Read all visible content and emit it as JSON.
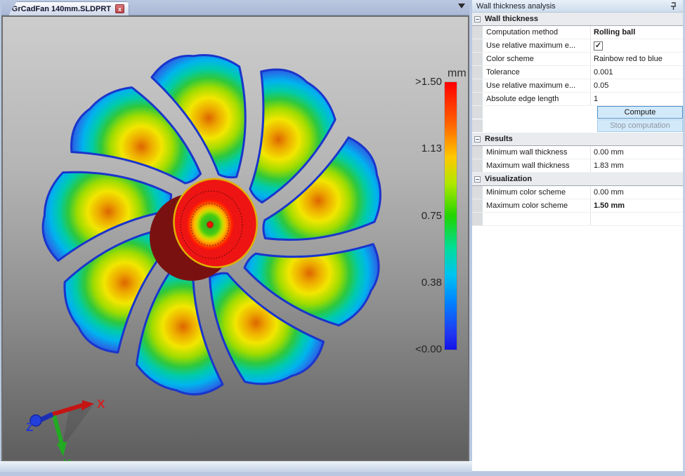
{
  "tab_bar": {
    "tabs": [
      {
        "title": "GrCadFan 140mm.SLDPRT"
      }
    ],
    "close_glyph": "x"
  },
  "viewport": {
    "colorbar": {
      "unit": "mm",
      "tick_labels": [
        ">1.50",
        "1.13",
        "0.75",
        "0.38",
        "<0.00"
      ],
      "gradient_stops": [
        [
          "#ff0000",
          0
        ],
        [
          "#ff6600",
          16
        ],
        [
          "#ffc800",
          28
        ],
        [
          "#aee800",
          38
        ],
        [
          "#22d400",
          50
        ],
        [
          "#00dd99",
          62
        ],
        [
          "#00c4f2",
          72
        ],
        [
          "#0084ff",
          82
        ],
        [
          "#2136f2",
          94
        ],
        [
          "#1313e8",
          100
        ]
      ],
      "min_value": "<0.00",
      "max_value": ">1.50"
    },
    "axes_triad": {
      "x_label": "X",
      "y_label": "Y",
      "z_label": "Z",
      "x_color": "#d42020",
      "y_color": "#1fae1f",
      "z_color": "#2336d4"
    }
  },
  "panel": {
    "title": "Wall thickness analysis",
    "rows": [
      {
        "type": "group",
        "label": "Wall thickness"
      },
      {
        "type": "prop",
        "label": "Computation method",
        "value": "Rolling ball",
        "bold": true
      },
      {
        "type": "check",
        "label": "Use relative maximum e...",
        "checked": true,
        "check_glyph": "✓"
      },
      {
        "type": "prop",
        "label": "Color scheme",
        "value": "Rainbow red to blue"
      },
      {
        "type": "prop",
        "label": "Tolerance",
        "value": "0.001"
      },
      {
        "type": "prop",
        "label": "Use relative maximum e...",
        "value": "0.05"
      },
      {
        "type": "prop",
        "label": "Absolute edge length",
        "value": "1"
      },
      {
        "type": "button",
        "label": "Compute",
        "enabled": true
      },
      {
        "type": "button",
        "label": "Stop computation",
        "enabled": false
      },
      {
        "type": "group",
        "label": "Results"
      },
      {
        "type": "prop",
        "label": "Minimum wall thickness",
        "value": "0.00 mm"
      },
      {
        "type": "prop",
        "label": "Maximum wall thickness",
        "value": "1.83 mm"
      },
      {
        "type": "group",
        "label": "Visualization"
      },
      {
        "type": "prop",
        "label": "Minimum color scheme",
        "value": "0.00 mm"
      },
      {
        "type": "prop",
        "label": "Maximum color scheme",
        "value": "1.50 mm",
        "bold": true
      },
      {
        "type": "empty"
      }
    ]
  }
}
